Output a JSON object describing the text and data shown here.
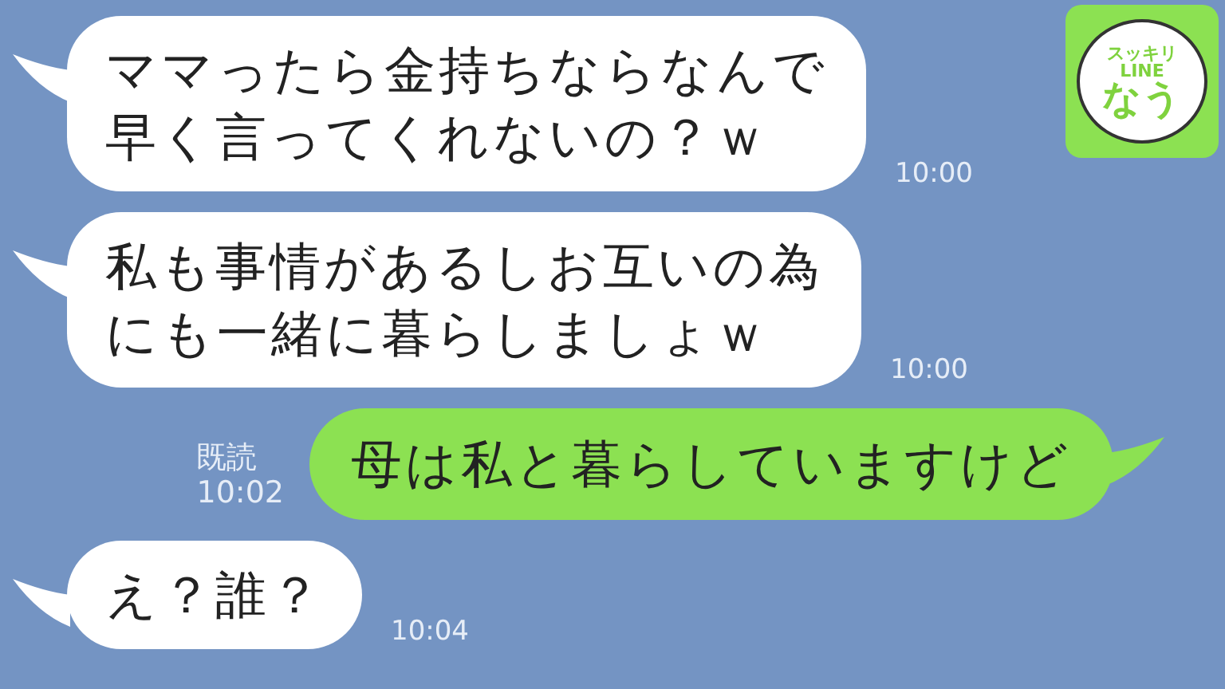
{
  "messages": [
    {
      "kind": "received",
      "lines": [
        "ママったら金持ちならなんで",
        "早く言ってくれないの？ｗ"
      ],
      "time": "10:00"
    },
    {
      "kind": "received",
      "lines": [
        "私も事情があるしお互いの為",
        "にも一緒に暮らしましょｗ"
      ],
      "time": "10:00"
    },
    {
      "kind": "sent",
      "lines": [
        "母は私と暮らしていますけど"
      ],
      "read": "既読",
      "time": "10:02"
    },
    {
      "kind": "received",
      "lines": [
        "え？誰？"
      ],
      "time": "10:04"
    }
  ],
  "logo": {
    "lines": [
      "スッキリ",
      "LINE",
      "なう"
    ]
  }
}
